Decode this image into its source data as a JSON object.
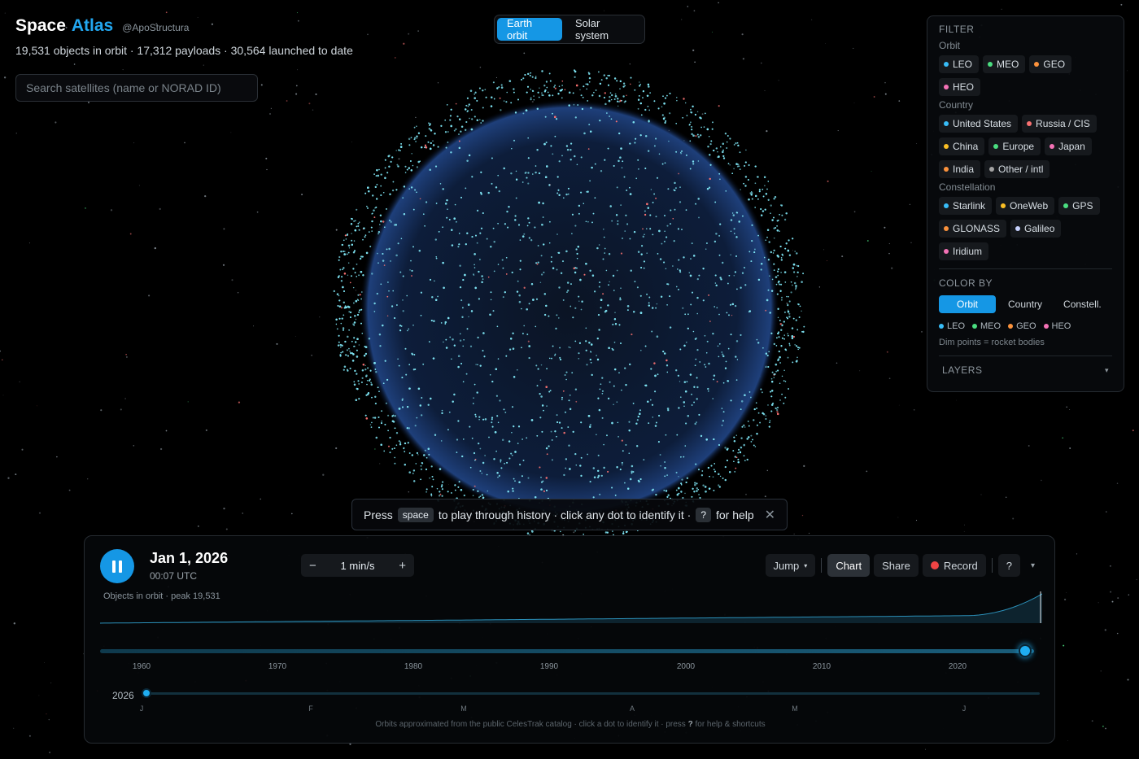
{
  "header": {
    "brand_word1": "Space",
    "brand_word2": "Atlas",
    "handle": "@ApoStructura",
    "stats": "19,531 objects in orbit · 17,312 payloads · 30,564 launched to date"
  },
  "search": {
    "placeholder": "Search satellites (name or NORAD ID)",
    "value": ""
  },
  "mode": {
    "options": [
      "Earth orbit",
      "Solar system"
    ],
    "selected": "Earth orbit"
  },
  "filter": {
    "title": "FILTER",
    "orbit_label": "Orbit",
    "orbit": [
      {
        "label": "LEO",
        "color": "#38bdf8"
      },
      {
        "label": "MEO",
        "color": "#4ade80"
      },
      {
        "label": "GEO",
        "color": "#fb923c"
      },
      {
        "label": "HEO",
        "color": "#f472b6"
      }
    ],
    "country_label": "Country",
    "country": [
      {
        "label": "United States",
        "color": "#38bdf8"
      },
      {
        "label": "Russia / CIS",
        "color": "#f87171"
      },
      {
        "label": "China",
        "color": "#fbbf24"
      },
      {
        "label": "Europe",
        "color": "#4ade80"
      },
      {
        "label": "Japan",
        "color": "#f472b6"
      },
      {
        "label": "India",
        "color": "#fb923c"
      },
      {
        "label": "Other / intl",
        "color": "#a3a3a3"
      }
    ],
    "constellation_label": "Constellation",
    "constellation": [
      {
        "label": "Starlink",
        "color": "#38bdf8"
      },
      {
        "label": "OneWeb",
        "color": "#fbbf24"
      },
      {
        "label": "GPS",
        "color": "#4ade80"
      },
      {
        "label": "GLONASS",
        "color": "#fb923c"
      },
      {
        "label": "Galileo",
        "color": "#c7d2fe"
      },
      {
        "label": "Iridium",
        "color": "#f472b6"
      }
    ],
    "colorby_title": "COLOR BY",
    "colorby_options": [
      "Orbit",
      "Country",
      "Constell."
    ],
    "colorby_selected": "Orbit",
    "legend": [
      {
        "label": "LEO",
        "color": "#38bdf8"
      },
      {
        "label": "MEO",
        "color": "#4ade80"
      },
      {
        "label": "GEO",
        "color": "#fb923c"
      },
      {
        "label": "HEO",
        "color": "#f472b6"
      }
    ],
    "note": "Dim points = rocket bodies",
    "layers_title": "LAYERS",
    "layers_chevron": "▾"
  },
  "hint": {
    "press": "Press",
    "space_key": "space",
    "middle": "to play through history · click any dot to identify it ·",
    "help_key": "?",
    "end": "for help",
    "close": "✕"
  },
  "timeline": {
    "date": "Jan 1, 2026",
    "time": "00:07 UTC",
    "speed": "1 min/s",
    "minus": "−",
    "plus": "+",
    "tools": {
      "jump": "Jump",
      "chart": "Chart",
      "share": "Share",
      "record": "Record",
      "help": "?",
      "more": "▾"
    },
    "caption": "Objects in orbit · peak 19,531",
    "years": [
      "1960",
      "1970",
      "1980",
      "1990",
      "2000",
      "2010",
      "2020"
    ],
    "year_position": 0.99,
    "current_year": "2026",
    "month_position": 0.0,
    "months": [
      "J",
      "F",
      "M",
      "A",
      "M",
      "J"
    ],
    "footnote_a": "Orbits approximated from the public CelesTrak catalog · click a dot to identify it · press",
    "footnote_key": "?",
    "footnote_b": "for help & shortcuts"
  },
  "colors": {
    "accent": "#1597e5",
    "record": "#ef4444"
  }
}
